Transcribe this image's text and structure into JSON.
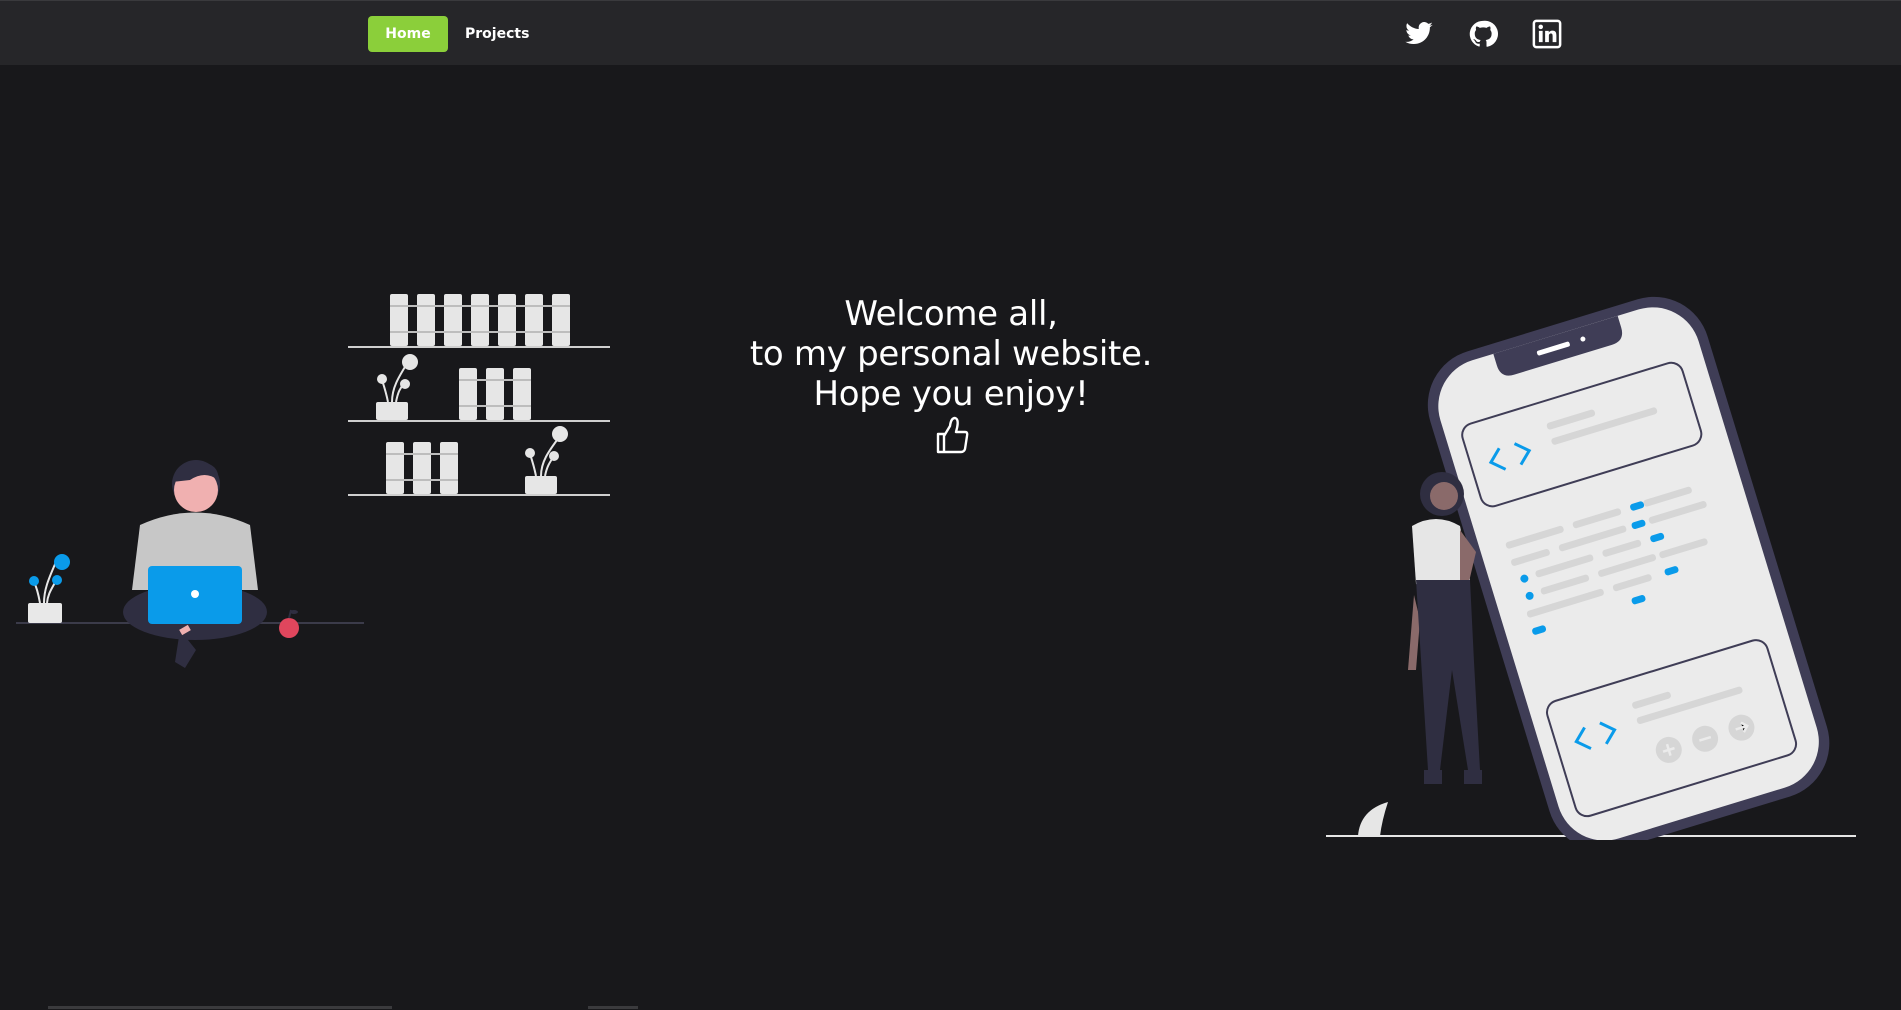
{
  "nav": {
    "home_label": "Home",
    "projects_label": "Projects",
    "active_color": "#8bcf3a"
  },
  "social": {
    "icons": [
      "twitter-icon",
      "github-icon",
      "linkedin-icon"
    ]
  },
  "hero": {
    "line1": "Welcome all,",
    "line2": "to my personal website.",
    "line3": "Hope you enjoy!",
    "emoji_icon": "thumbs-up-icon"
  },
  "colors": {
    "background": "#18181b",
    "navbar": "#262629",
    "accent_blue": "#0a9bea",
    "apple_red": "#e0465d"
  }
}
